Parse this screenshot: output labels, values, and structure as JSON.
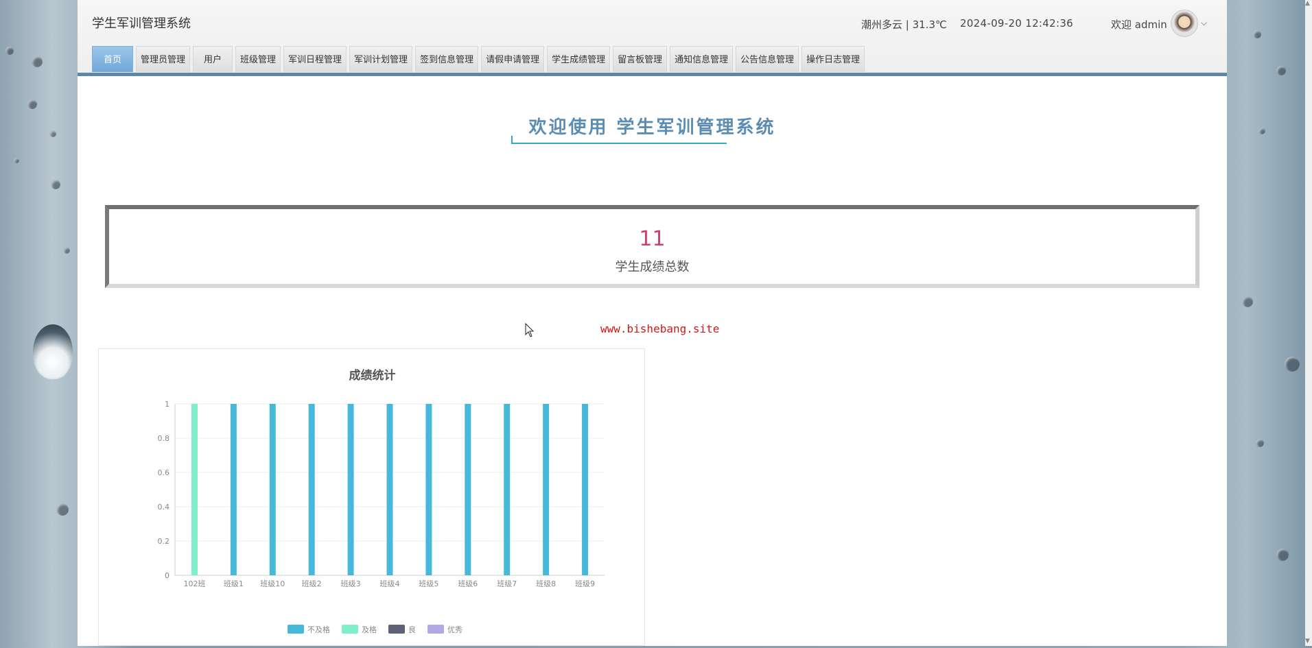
{
  "app": {
    "title": "学生军训管理系统"
  },
  "header": {
    "weather": "潮州多云 | 31.3℃",
    "datetime": "2024-09-20  12:42:36",
    "welcome": "欢迎 admin",
    "chevron": "⌵"
  },
  "nav": {
    "items": [
      {
        "label": "首页",
        "active": true
      },
      {
        "label": "管理员管理"
      },
      {
        "label": "用户"
      },
      {
        "label": "班级管理"
      },
      {
        "label": "军训日程管理"
      },
      {
        "label": "军训计划管理"
      },
      {
        "label": "签到信息管理"
      },
      {
        "label": "请假申请管理"
      },
      {
        "label": "学生成绩管理"
      },
      {
        "label": "留言板管理"
      },
      {
        "label": "通知信息管理"
      },
      {
        "label": "公告信息管理"
      },
      {
        "label": "操作日志管理"
      }
    ]
  },
  "main": {
    "welcome_title": "欢迎使用 学生军训管理系统",
    "stat": {
      "value": "11",
      "label": "学生成绩总数"
    },
    "watermark": "www.bishebang.site"
  },
  "chart_data": {
    "type": "bar",
    "title": "成绩统计",
    "categories": [
      "102班",
      "班级1",
      "班级10",
      "班级2",
      "班级3",
      "班级4",
      "班级5",
      "班级6",
      "班级7",
      "班级8",
      "班级9"
    ],
    "series": [
      {
        "name": "不及格",
        "color": "#46b8da",
        "values": [
          0,
          1,
          1,
          1,
          1,
          1,
          1,
          1,
          1,
          1,
          1
        ]
      },
      {
        "name": "及格",
        "color": "#7ef0c8",
        "values": [
          1,
          0,
          0,
          0,
          0,
          0,
          0,
          0,
          0,
          0,
          0
        ]
      },
      {
        "name": "良",
        "color": "#5e6178",
        "values": [
          0,
          0,
          0,
          0,
          0,
          0,
          0,
          0,
          0,
          0,
          0
        ]
      },
      {
        "name": "优秀",
        "color": "#b3a7e6",
        "values": [
          0,
          0,
          0,
          0,
          0,
          0,
          0,
          0,
          0,
          0,
          0
        ]
      }
    ],
    "yticks": [
      "0",
      "0.2",
      "0.4",
      "0.6",
      "0.8",
      "1"
    ],
    "ylim": [
      0,
      1
    ],
    "grid": true,
    "legend_position": "bottom"
  }
}
